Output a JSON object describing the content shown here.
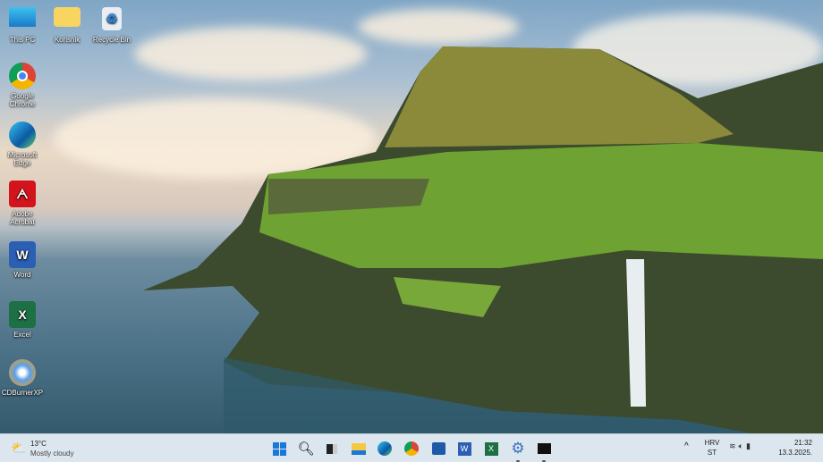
{
  "desktop": {
    "icons": [
      {
        "label": "This PC",
        "icon": "monitor-icon"
      },
      {
        "label": "Korisnik",
        "icon": "folder-icon"
      },
      {
        "label": "Recycle Bin",
        "icon": "recycle-bin-icon"
      },
      {
        "label": "Google Chrome",
        "icon": "chrome-icon"
      },
      {
        "label": "Microsoft Edge",
        "icon": "edge-icon"
      },
      {
        "label": "Adobe Acrobat",
        "icon": "acrobat-icon"
      },
      {
        "label": "Word",
        "icon": "word-icon"
      },
      {
        "label": "Excel",
        "icon": "excel-icon"
      },
      {
        "label": "CDBurnerXP",
        "icon": "cdburner-icon"
      }
    ]
  },
  "taskbar": {
    "weather": {
      "temp": "13°C",
      "condition": "Mostly cloudy"
    },
    "apps": [
      "start",
      "search",
      "task-view",
      "file-explorer",
      "edge",
      "chrome",
      "store",
      "word",
      "excel",
      "settings",
      "terminal"
    ],
    "language": {
      "line1": "HRV",
      "line2": "ST"
    },
    "time": "21:32",
    "date": "13.3.2025."
  },
  "colors": {
    "taskbar": "#dce6ee",
    "accent": "#0a64c8"
  }
}
